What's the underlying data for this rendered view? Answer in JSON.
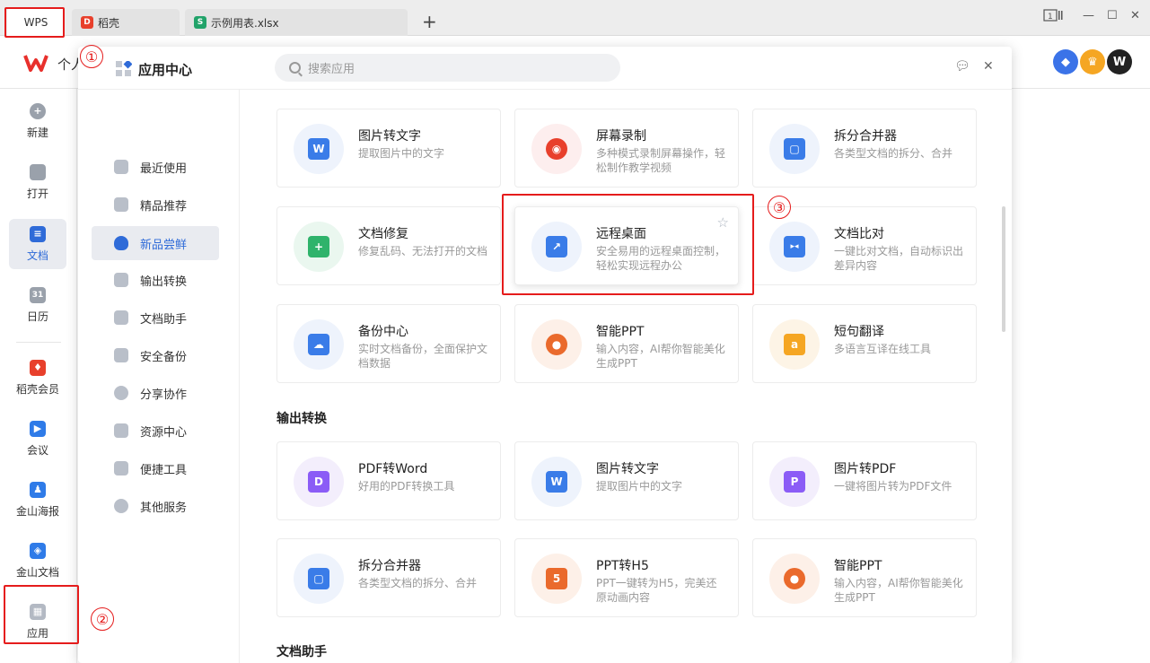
{
  "tabs": [
    {
      "label": "WPS"
    },
    {
      "label": "稻壳"
    },
    {
      "label": "示例用表.xlsx"
    }
  ],
  "header": {
    "title": "个人"
  },
  "rail": [
    {
      "label": "新建",
      "icon": "plus-circle-icon"
    },
    {
      "label": "打开",
      "icon": "folder-icon"
    },
    {
      "label": "文档",
      "icon": "document-icon"
    },
    {
      "label": "日历",
      "icon": "calendar-icon"
    },
    {
      "label": "稻壳会员",
      "icon": "docer-icon"
    },
    {
      "label": "会议",
      "icon": "meeting-icon"
    },
    {
      "label": "金山海报",
      "icon": "poster-icon"
    },
    {
      "label": "金山文档",
      "icon": "kdocs-icon"
    },
    {
      "label": "应用",
      "icon": "apps-icon"
    }
  ],
  "calendar_day": "31",
  "modal": {
    "title": "应用中心",
    "search_placeholder": "搜索应用",
    "sidebar": [
      {
        "label": "最近使用"
      },
      {
        "label": "精品推荐"
      },
      {
        "label": "新品尝鲜"
      },
      {
        "label": "输出转换"
      },
      {
        "label": "文档助手"
      },
      {
        "label": "安全备份"
      },
      {
        "label": "分享协作"
      },
      {
        "label": "资源中心"
      },
      {
        "label": "便捷工具"
      },
      {
        "label": "其他服务"
      }
    ],
    "cards": [
      {
        "title": "图片转文字",
        "desc": "提取图片中的文字",
        "glyph": "W"
      },
      {
        "title": "屏幕录制",
        "desc": "多种模式录制屏幕操作，轻松制作教学视频",
        "glyph": "◉"
      },
      {
        "title": "拆分合并器",
        "desc": "各类型文档的拆分、合并",
        "glyph": "▢"
      },
      {
        "title": "文档修复",
        "desc": "修复乱码、无法打开的文档",
        "glyph": "+"
      },
      {
        "title": "远程桌面",
        "desc": "安全易用的远程桌面控制，轻松实现远程办公",
        "glyph": "↗"
      },
      {
        "title": "文档比对",
        "desc": "一键比对文档，自动标识出差异内容",
        "glyph": "▸◂"
      },
      {
        "title": "备份中心",
        "desc": "实时文档备份，全面保护文档数据",
        "glyph": "☁"
      },
      {
        "title": "智能PPT",
        "desc": "输入内容，AI帮你智能美化生成PPT",
        "glyph": "●"
      },
      {
        "title": "短句翻译",
        "desc": "多语言互译在线工具",
        "glyph": "a"
      }
    ],
    "section_output": "输出转换",
    "cards_output": [
      {
        "title": "PDF转Word",
        "desc": "好用的PDF转换工具",
        "glyph": "D"
      },
      {
        "title": "图片转文字",
        "desc": "提取图片中的文字",
        "glyph": "W"
      },
      {
        "title": "图片转PDF",
        "desc": "一键将图片转为PDF文件",
        "glyph": "P"
      },
      {
        "title": "拆分合并器",
        "desc": "各类型文档的拆分、合并",
        "glyph": "▢"
      },
      {
        "title": "PPT转H5",
        "desc": "PPT一键转为H5，完美还原动画内容",
        "glyph": "5"
      },
      {
        "title": "智能PPT",
        "desc": "输入内容，AI帮你智能美化生成PPT",
        "glyph": "●"
      }
    ],
    "section_assistant": "文档助手"
  },
  "annotations": [
    "①",
    "②",
    "③"
  ],
  "colors": {
    "accent": "#2f6bd8",
    "wps_red": "#e8302c",
    "annotation_red": "#e51c1c"
  }
}
